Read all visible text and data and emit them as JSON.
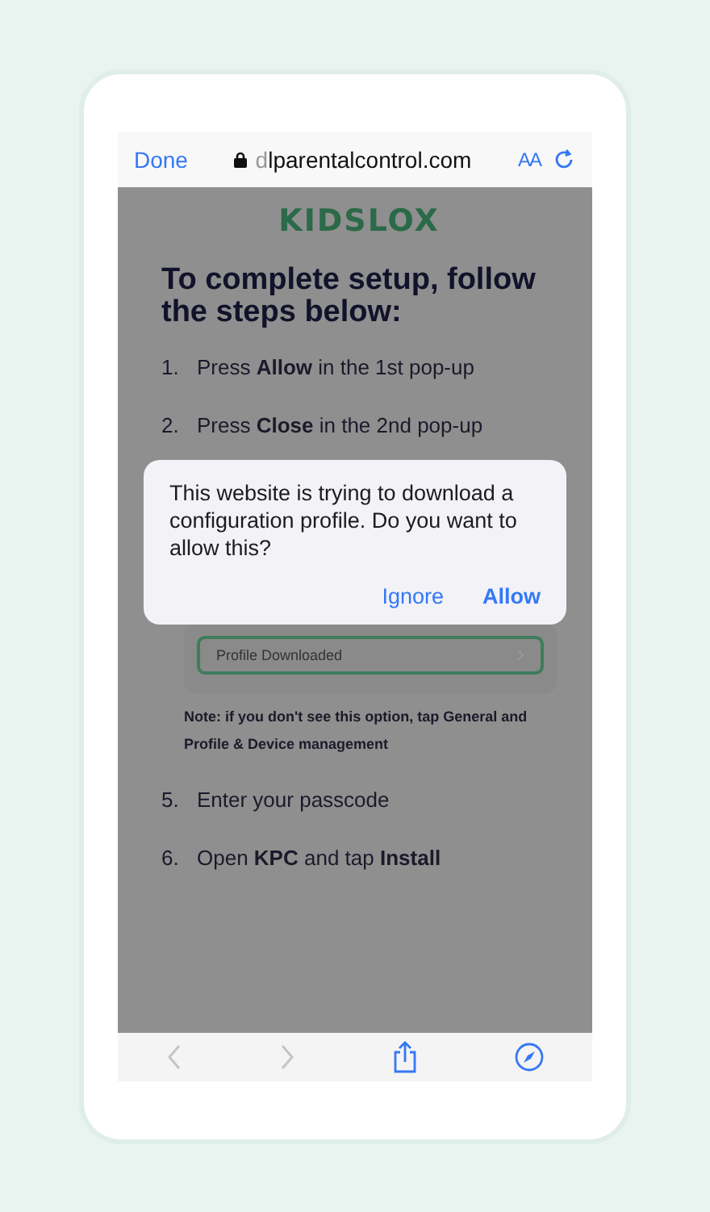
{
  "browser_bar": {
    "done": "Done",
    "url_prefix": "d",
    "url": "lparentalcontrol.com",
    "text_size": "AA"
  },
  "page": {
    "logo": "KIDSLOX",
    "heading": "To complete setup, follow the steps below:",
    "steps_top": [
      {
        "number": "1.",
        "text": "Press **Allow** in the 1st pop-up"
      },
      {
        "number": "2.",
        "text": "Press **Close** in the 2nd pop-up"
      }
    ],
    "profile_row": {
      "label": "Profile Downloaded"
    },
    "note": "Note: if you don't see this option, tap General and Profile & Device management",
    "steps_bottom": [
      {
        "number": "5.",
        "text": "Enter your passcode"
      },
      {
        "number": "6.",
        "text": "Open **KPC** and tap **Install**"
      }
    ]
  },
  "dialog": {
    "message": "This website is trying to download a configuration profile. Do you want to allow this?",
    "buttons": [
      {
        "label": "Ignore",
        "kind": "secondary"
      },
      {
        "label": "Allow",
        "kind": "primary"
      }
    ]
  },
  "toolbar": {
    "back": {
      "disabled": true
    },
    "forward": {
      "disabled": true
    }
  }
}
